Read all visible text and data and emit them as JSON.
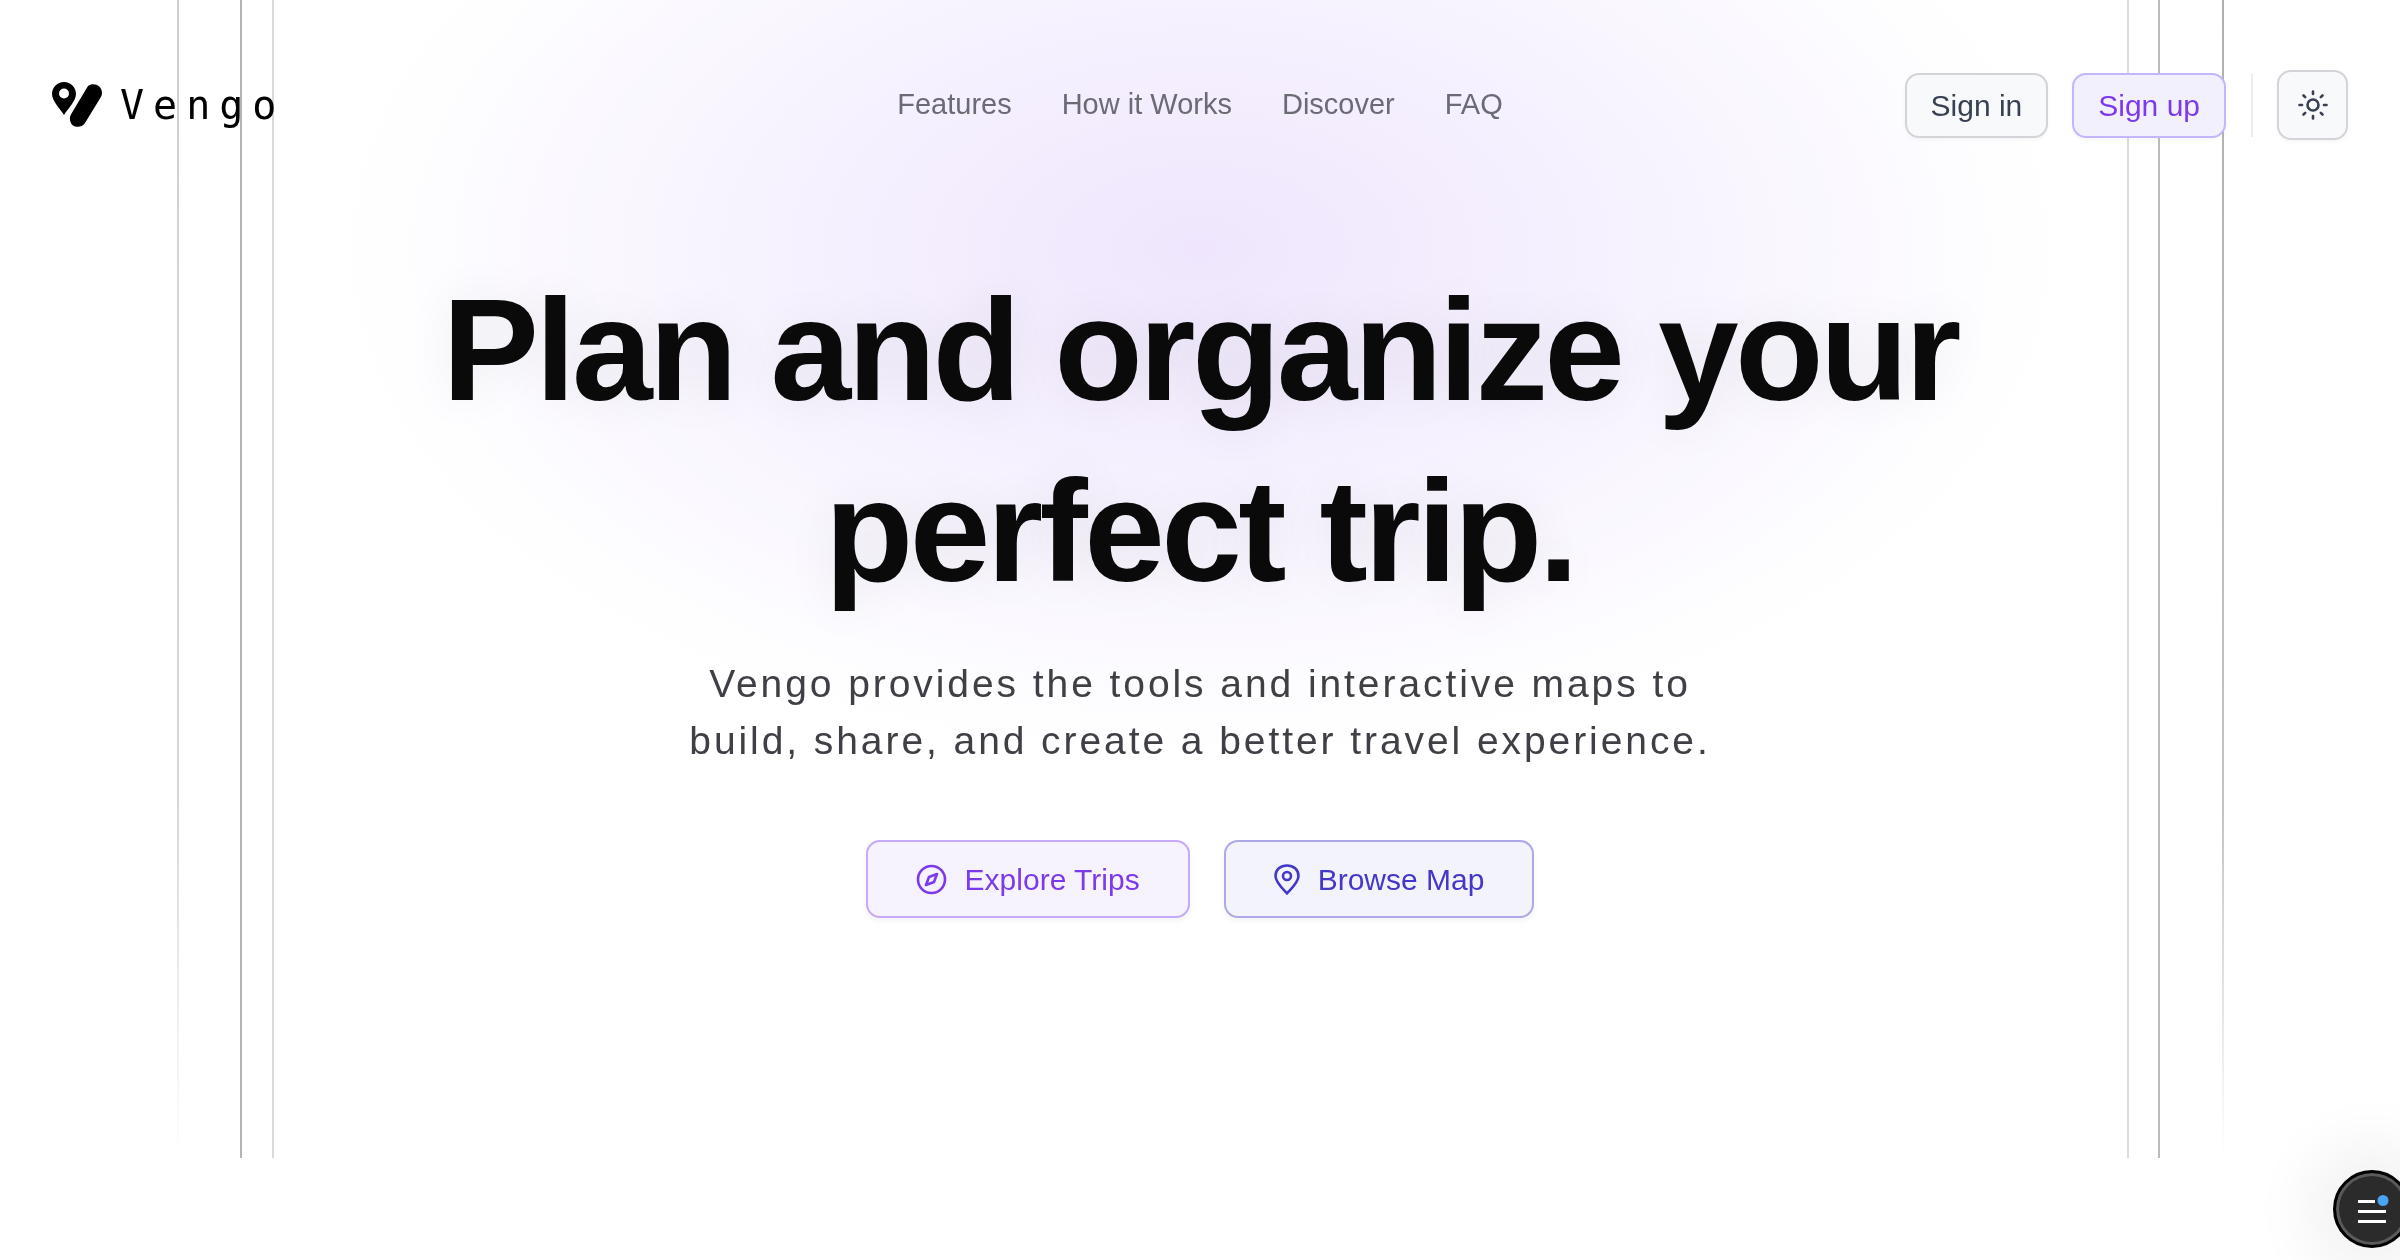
{
  "header": {
    "logo": {
      "text": "Vengo"
    },
    "nav_links": [
      "Features",
      "How it Works",
      "Discover",
      "FAQ"
    ],
    "sign_in": "Sign in",
    "sign_up": "Sign up"
  },
  "hero": {
    "title": "Plan and organize your perfect trip.",
    "subtitle": "Vengo provides the tools and interactive maps to build, share, and create a better travel experience.",
    "buttons": [
      {
        "label": "Explore Trips",
        "color": "#7c3aed"
      },
      {
        "label": "Browse Map",
        "color": "#4338ca"
      }
    ]
  }
}
